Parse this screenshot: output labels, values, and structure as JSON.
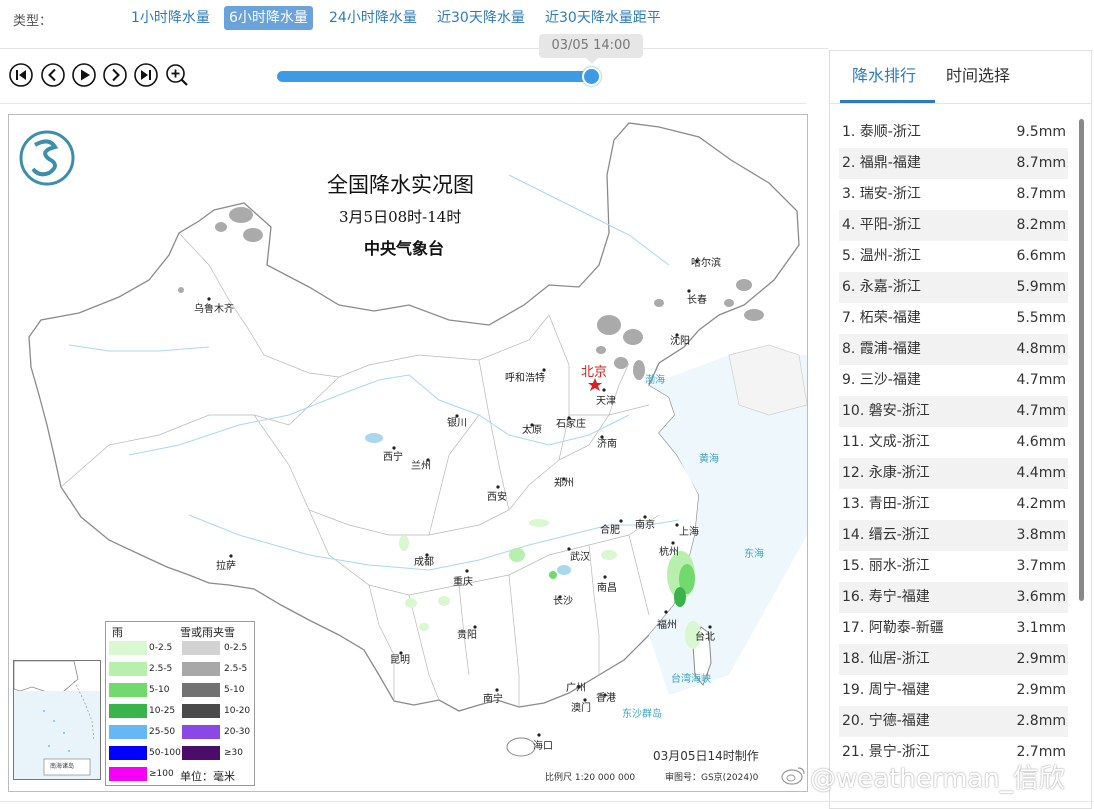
{
  "typebar": {
    "label": "类型：",
    "tabs": [
      {
        "label": "1小时降水量",
        "active": false
      },
      {
        "label": "6小时降水量",
        "active": true
      },
      {
        "label": "24小时降水量",
        "active": false
      },
      {
        "label": "近30天降水量",
        "active": false
      },
      {
        "label": "近30天降水量距平",
        "active": false
      }
    ]
  },
  "player": {
    "time_tooltip": "03/05 14:00",
    "progress": 1.0,
    "controls": [
      "first-frame-icon",
      "prev-frame-icon",
      "play-icon",
      "next-frame-icon",
      "last-frame-icon",
      "zoom-in-icon"
    ]
  },
  "map": {
    "title": "全国降水实况图",
    "subtitle": "3月5日08时-14时",
    "source": "中央气象台",
    "cities": {
      "beijing": "北京",
      "tianjin": "天津",
      "harbin": "哈尔滨",
      "changchun": "长春",
      "shenyang": "沈阳",
      "hohhot": "呼和浩特",
      "shijiazhuang": "石家庄",
      "taiyuan": "太原",
      "jinan": "济南",
      "yinchuan": "银川",
      "xining": "西宁",
      "lanzhou": "兰州",
      "xian": "西安",
      "zhengzhou": "郑州",
      "hefei": "合肥",
      "nanjing": "南京",
      "shanghai": "上海",
      "hangzhou": "杭州",
      "wuhan": "武汉",
      "chengdu": "成都",
      "chongqing": "重庆",
      "changsha": "长沙",
      "nanchang": "南昌",
      "fuzhou": "福州",
      "taibei": "台北",
      "guiyang": "贵阳",
      "kunming": "昆明",
      "nanning": "南宁",
      "guangzhou": "广州",
      "hongkong": "香港",
      "macao": "澳门",
      "haikou": "海口",
      "urumqi": "乌鲁木齐",
      "lhasa": "拉萨"
    },
    "seas": {
      "bohai": "渤海",
      "huanghai": "黄海",
      "donghai": "东海",
      "taiwan_strait": "台湾海峡",
      "dongsha": "东沙群岛"
    },
    "legend": {
      "rain_title": "雨",
      "snow_title": "雪或雨夹雪",
      "rain": [
        {
          "label": "0-2.5",
          "color": "#d9f7d0"
        },
        {
          "label": "2.5-5",
          "color": "#b8efad"
        },
        {
          "label": "5-10",
          "color": "#72d96c"
        },
        {
          "label": "10-25",
          "color": "#38b44a"
        },
        {
          "label": "25-50",
          "color": "#66b8f4"
        },
        {
          "label": "50-100",
          "color": "#0000fe"
        },
        {
          "label": "≥100",
          "color": "#f500f5"
        }
      ],
      "snow": [
        {
          "label": "0-2.5",
          "color": "#d2d2d2"
        },
        {
          "label": "2.5-5",
          "color": "#a8a8a8"
        },
        {
          "label": "5-10",
          "color": "#727272"
        },
        {
          "label": "10-20",
          "color": "#4a4a4a"
        },
        {
          "label": "20-30",
          "color": "#8a48e6"
        },
        {
          "label": "≥30",
          "color": "#4c0c6a"
        }
      ],
      "unit": "单位：毫米"
    },
    "made_time": "03月05日14时制作",
    "scale": "比例尺 1:20 000 000",
    "approval": "审图号：GS京(2024)0",
    "inset_label": "南海诸岛"
  },
  "panel": {
    "tabs": [
      {
        "label": "降水排行",
        "active": true
      },
      {
        "label": "时间选择",
        "active": false
      }
    ],
    "ranking": [
      {
        "name": "1. 泰顺-浙江",
        "value": "9.5mm"
      },
      {
        "name": "2. 福鼎-福建",
        "value": "8.7mm"
      },
      {
        "name": "3. 瑞安-浙江",
        "value": "8.7mm"
      },
      {
        "name": "4. 平阳-浙江",
        "value": "8.2mm"
      },
      {
        "name": "5. 温州-浙江",
        "value": "6.6mm"
      },
      {
        "name": "6. 永嘉-浙江",
        "value": "5.9mm"
      },
      {
        "name": "7. 柘荣-福建",
        "value": "5.5mm"
      },
      {
        "name": "8. 霞浦-福建",
        "value": "4.8mm"
      },
      {
        "name": "9. 三沙-福建",
        "value": "4.7mm"
      },
      {
        "name": "10. 磐安-浙江",
        "value": "4.7mm"
      },
      {
        "name": "11. 文成-浙江",
        "value": "4.6mm"
      },
      {
        "name": "12. 永康-浙江",
        "value": "4.4mm"
      },
      {
        "name": "13. 青田-浙江",
        "value": "4.2mm"
      },
      {
        "name": "14. 缙云-浙江",
        "value": "3.8mm"
      },
      {
        "name": "15. 丽水-浙江",
        "value": "3.7mm"
      },
      {
        "name": "16. 寿宁-福建",
        "value": "3.6mm"
      },
      {
        "name": "17. 阿勒泰-新疆",
        "value": "3.1mm"
      },
      {
        "name": "18. 仙居-浙江",
        "value": "2.9mm"
      },
      {
        "name": "19. 周宁-福建",
        "value": "2.9mm"
      },
      {
        "name": "20. 宁德-福建",
        "value": "2.8mm"
      },
      {
        "name": "21. 景宁-浙江",
        "value": "2.7mm"
      }
    ]
  },
  "watermark": "@weatherman_信欣"
}
